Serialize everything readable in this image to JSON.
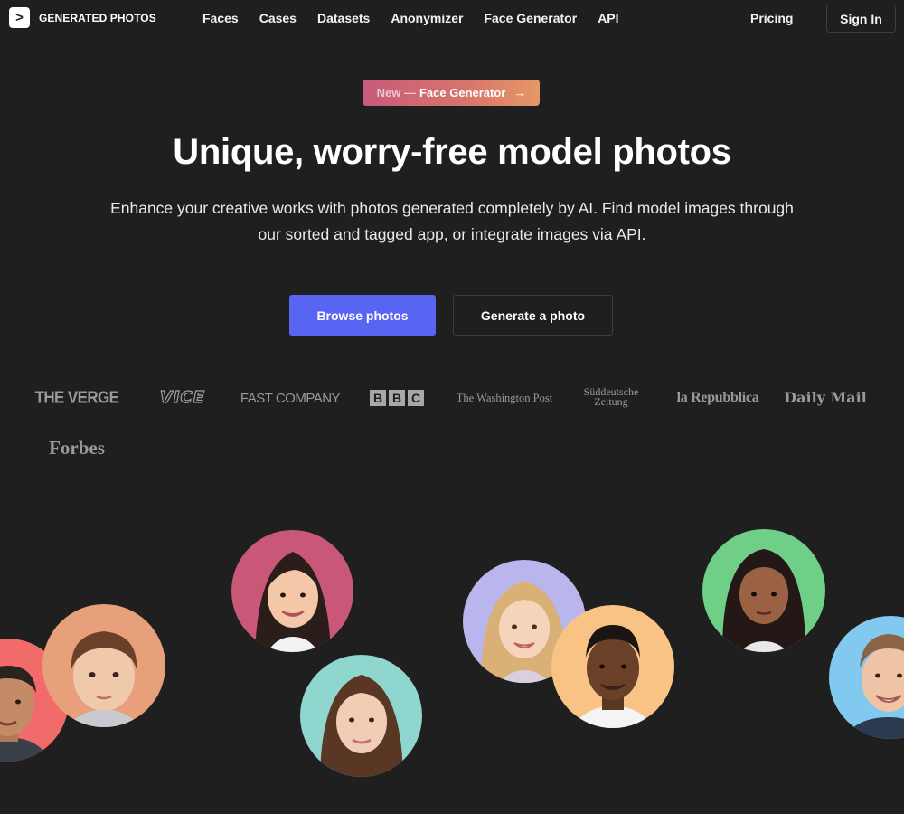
{
  "brand": {
    "logo_glyph": ">",
    "name": "GENERATED PHOTOS"
  },
  "nav": {
    "links": [
      "Faces",
      "Cases",
      "Datasets",
      "Anonymizer",
      "Face Generator",
      "API"
    ],
    "pricing": "Pricing",
    "sign_in": "Sign In"
  },
  "hero": {
    "badge_new": "New —",
    "badge_label": "Face Generator",
    "badge_arrow": "→",
    "title": "Unique, worry-free model photos",
    "subtitle": "Enhance your creative works with photos generated completely by AI. Find model images through our sorted and tagged app, or integrate images via API.",
    "primary_button": "Browse photos",
    "secondary_button": "Generate a photo"
  },
  "press": {
    "verge": "THE VERGE",
    "vice": "VICE",
    "fastcompany": "FAST COMPANY",
    "bbc": [
      "B",
      "B",
      "C"
    ],
    "wapo": "The Washington Post",
    "sz_line1": "Süddeutsche",
    "sz_line2": "Zeitung",
    "repubblica": "la Repubblica",
    "dailymail": "Daily Mail",
    "forbes": "Forbes"
  },
  "colors": {
    "background": "#1f1f1f",
    "primary_button": "#5865f2",
    "badge_gradient_start": "#c85a7a",
    "badge_gradient_end": "#e69866",
    "face_backgrounds": [
      "#f26b6b",
      "#e8a07a",
      "#c95777",
      "#8fd6cf",
      "#b8b6ec",
      "#f8c384",
      "#6fcf86",
      "#82c9ef"
    ]
  },
  "faces": [
    "man-avatar",
    "toddler-avatar",
    "woman-avatar",
    "young-woman-avatar",
    "girl-avatar",
    "young-man-avatar",
    "teen-girl-avatar",
    "smiling-man-avatar"
  ]
}
